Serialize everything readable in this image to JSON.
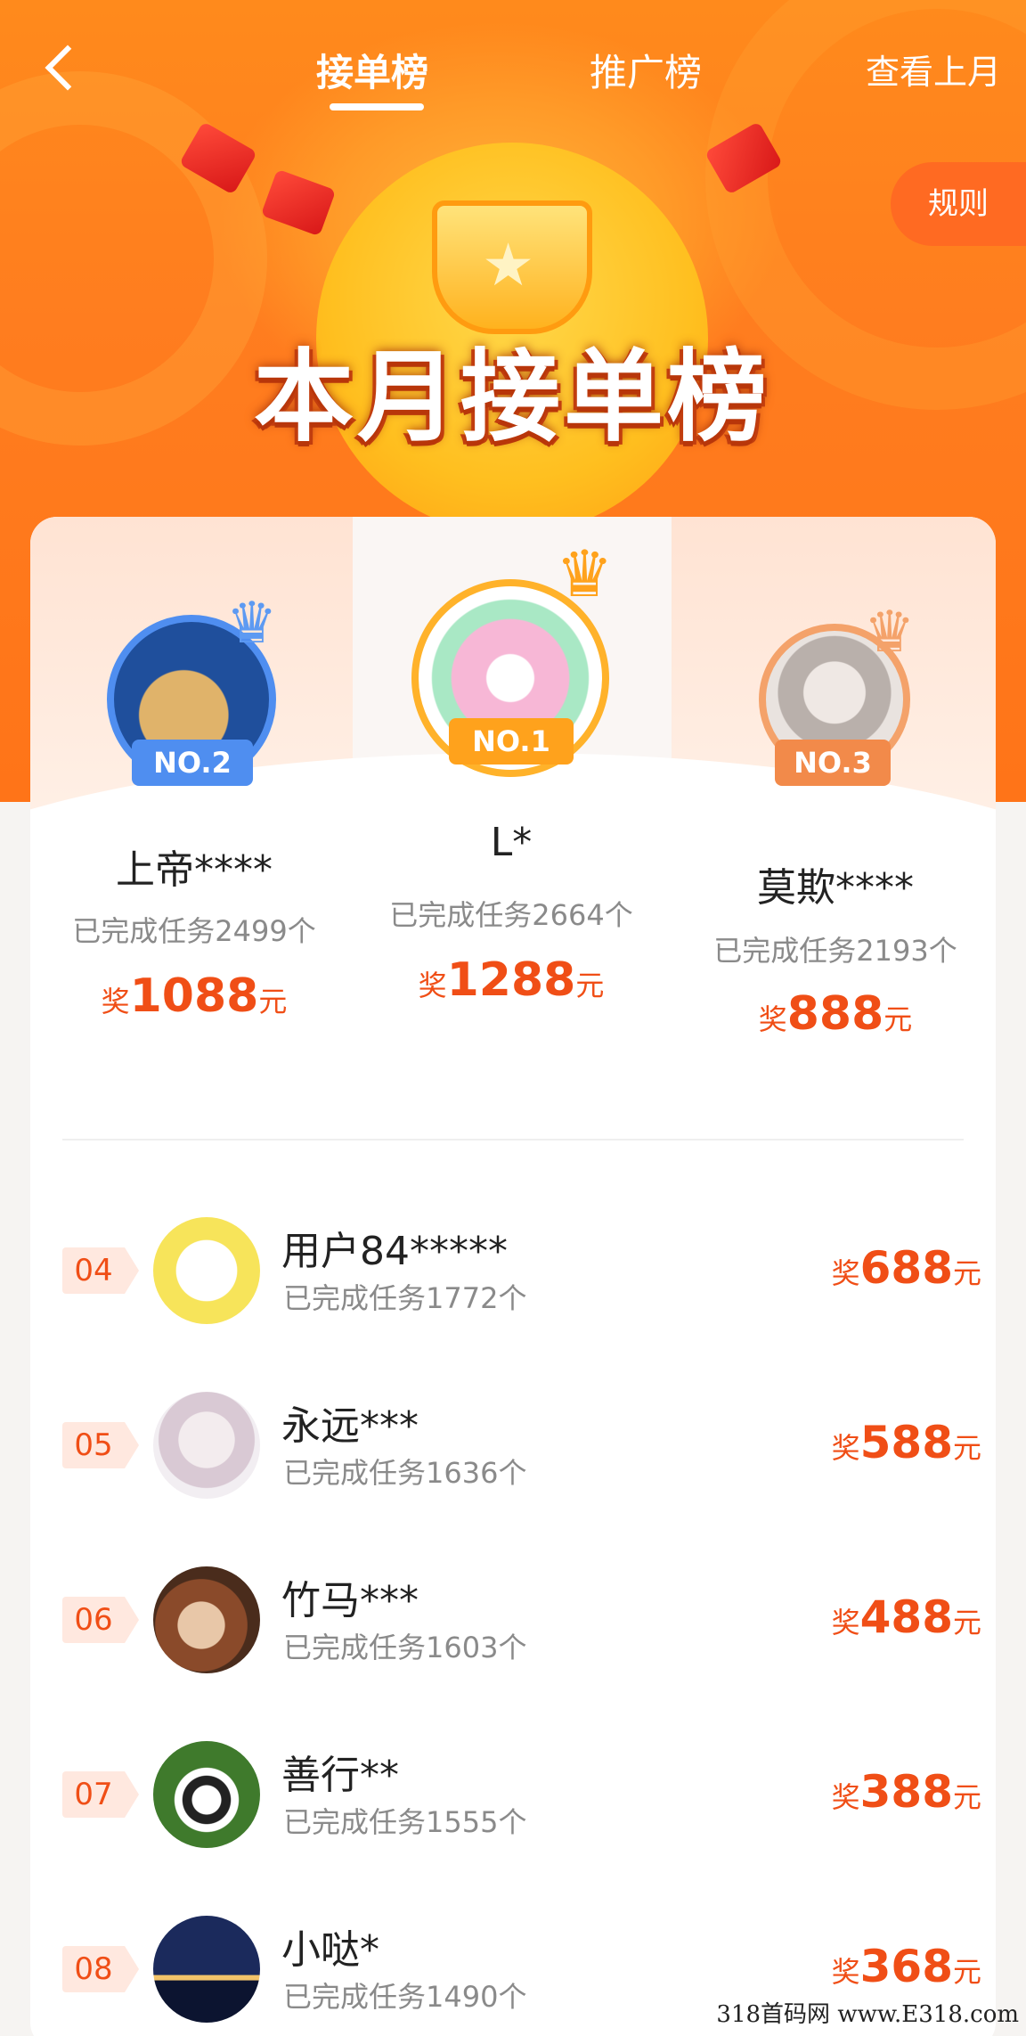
{
  "header": {
    "tabs": [
      {
        "label": "接单榜",
        "active": true
      },
      {
        "label": "推广榜",
        "active": false
      }
    ],
    "view_last_month": "查看上月",
    "rules": "规则",
    "banner_title": "本月接单榜"
  },
  "top3": [
    {
      "rank_badge": "NO.2",
      "name": "上帝****",
      "count_text": "已完成任务2499个",
      "prize_prefix": "奖",
      "prize": "1088",
      "prize_suffix": "元"
    },
    {
      "rank_badge": "NO.1",
      "name": "L*",
      "count_text": "已完成任务2664个",
      "prize_prefix": "奖",
      "prize": "1288",
      "prize_suffix": "元"
    },
    {
      "rank_badge": "NO.3",
      "name": "莫欺****",
      "count_text": "已完成任务2193个",
      "prize_prefix": "奖",
      "prize": "888",
      "prize_suffix": "元"
    }
  ],
  "list": [
    {
      "rank": "04",
      "name": "用户84*****",
      "count_text": "已完成任务1772个",
      "prize_prefix": "奖",
      "prize": "688",
      "prize_suffix": "元"
    },
    {
      "rank": "05",
      "name": "永远***",
      "count_text": "已完成任务1636个",
      "prize_prefix": "奖",
      "prize": "588",
      "prize_suffix": "元"
    },
    {
      "rank": "06",
      "name": "竹马***",
      "count_text": "已完成任务1603个",
      "prize_prefix": "奖",
      "prize": "488",
      "prize_suffix": "元"
    },
    {
      "rank": "07",
      "name": "善行**",
      "count_text": "已完成任务1555个",
      "prize_prefix": "奖",
      "prize": "388",
      "prize_suffix": "元"
    },
    {
      "rank": "08",
      "name": "小哒*",
      "count_text": "已完成任务1490个",
      "prize_prefix": "奖",
      "prize": "368",
      "prize_suffix": "元"
    }
  ],
  "watermark": "318首码网 www.E318.com",
  "colors": {
    "accent": "#f04e16",
    "hero": "#ff7d1f"
  }
}
